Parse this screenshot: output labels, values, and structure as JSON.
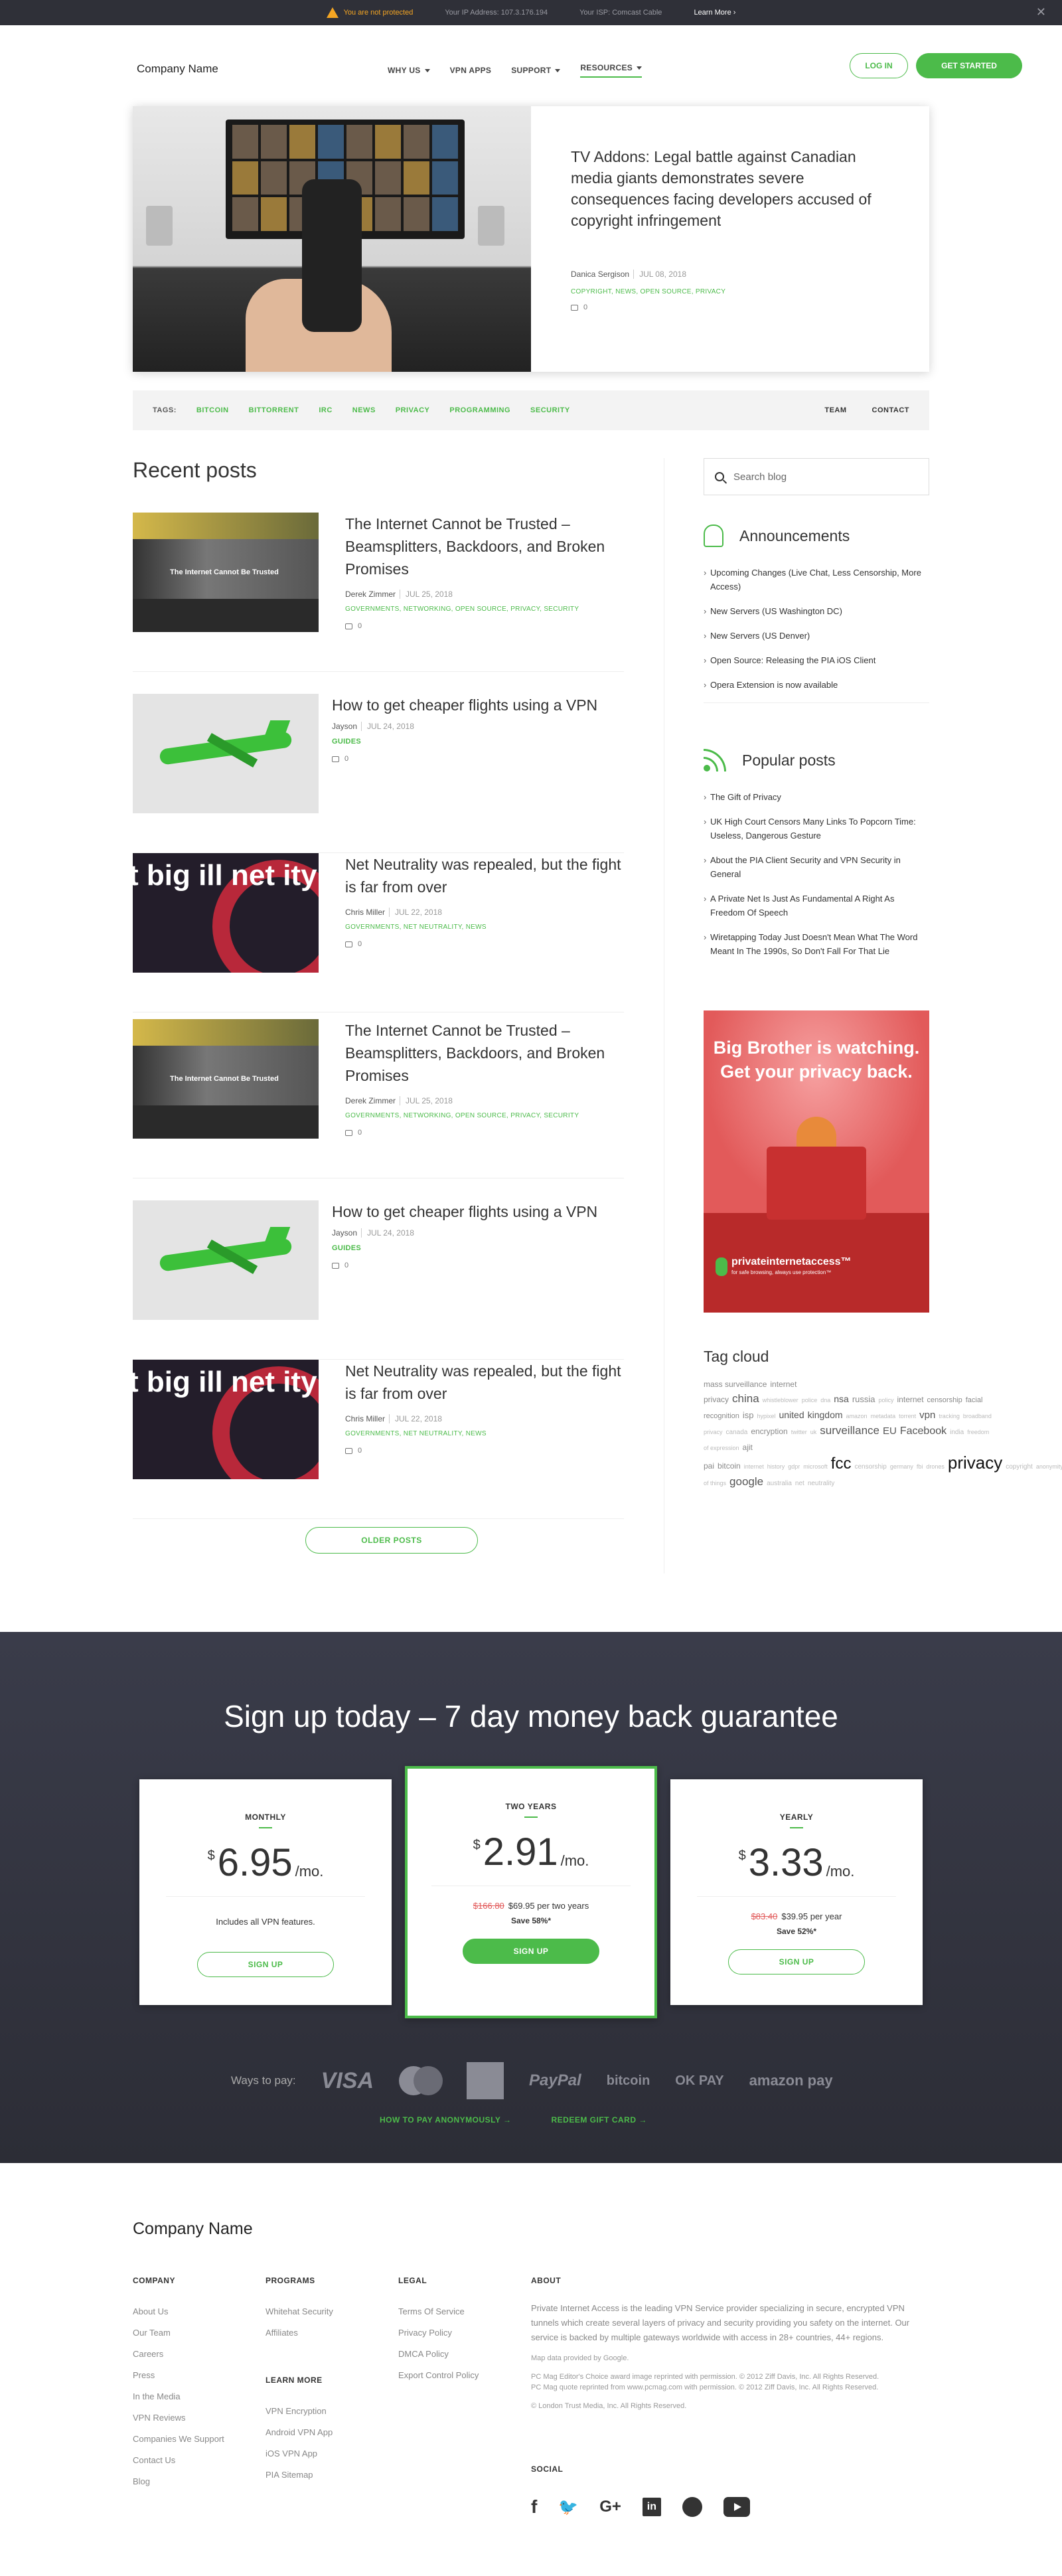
{
  "topbar": {
    "warning": "You are not protected",
    "ip": "Your IP Address: 107.3.176.194",
    "isp": "Your ISP: Comcast Cable",
    "learn_more": "Learn More ›",
    "close": "✕"
  },
  "header": {
    "logo": "Company Name",
    "nav": [
      "WHY US",
      "VPN APPS",
      "SUPPORT",
      "RESOURCES"
    ],
    "login": "LOG IN",
    "get_started": "GET STARTED"
  },
  "hero": {
    "title": "TV Addons: Legal battle against Canadian media giants demonstrates severe consequences facing developers accused of copyright infringement",
    "author": "Danica Sergison",
    "date": "JUL 08, 2018",
    "categories": "COPYRIGHT, NEWS, OPEN SOURCE, PRIVACY",
    "comments": "0"
  },
  "tagsbar": {
    "label": "TAGS:",
    "tags": [
      "BITCOIN",
      "BITTORRENT",
      "IRC",
      "NEWS",
      "PRIVACY",
      "PROGRAMMING",
      "SECURITY"
    ],
    "team": "TEAM",
    "contact": "CONTACT"
  },
  "recent": {
    "heading": "Recent posts",
    "posts": [
      {
        "title": "The Internet Cannot be Trusted – Beamsplitters, Backdoors, and Broken Promises",
        "author": "Derek Zimmer",
        "date": "JUL 25, 2018",
        "categories": "GOVERNMENTS, NETWORKING, OPEN SOURCE, PRIVACY, SECURITY",
        "comments": "0",
        "thumb_text": "The Internet Cannot Be Trusted"
      },
      {
        "title": "How to get cheaper flights using a VPN",
        "author": "Jayson",
        "date": "JUL 24, 2018",
        "categories": "GUIDES",
        "comments": "0"
      },
      {
        "title": "Net Neutrality was repealed, but the fight is far from over",
        "author": "Chris Miller",
        "date": "JUL 22, 2018",
        "categories": "GOVERNMENTS, NET NEUTRALITY, NEWS",
        "comments": "0",
        "thumb_text": "t big ill net ity"
      },
      {
        "title": "The Internet Cannot be Trusted – Beamsplitters, Backdoors, and Broken Promises",
        "author": "Derek Zimmer",
        "date": "JUL 25, 2018",
        "categories": "GOVERNMENTS, NETWORKING, OPEN SOURCE, PRIVACY, SECURITY",
        "comments": "0",
        "thumb_text": "The Internet Cannot Be Trusted"
      },
      {
        "title": "How to get cheaper flights using a VPN",
        "author": "Jayson",
        "date": "JUL 24, 2018",
        "categories": "GUIDES",
        "comments": "0"
      },
      {
        "title": "Net Neutrality was repealed, but the fight is far from over",
        "author": "Chris Miller",
        "date": "JUL 22, 2018",
        "categories": "GOVERNMENTS, NET NEUTRALITY, NEWS",
        "comments": "0",
        "thumb_text": "t big ill net ity"
      }
    ],
    "older": "OLDER POSTS"
  },
  "sidebar": {
    "search_placeholder": "Search blog",
    "announcements": {
      "title": "Announcements",
      "items": [
        "Upcoming Changes (Live Chat, Less Censorship, More Access)",
        "New Servers (US Washington DC)",
        "New Servers (US Denver)",
        "Open Source: Releasing the PIA iOS Client",
        "Opera Extension is now available"
      ]
    },
    "popular": {
      "title": "Popular posts",
      "items": [
        "The Gift of Privacy",
        "UK High Court Censors Many Links To Popcorn Time: Useless, Dangerous Gesture",
        "About the PIA Client Security and VPN Security in General",
        "A Private Net Is Just As Fundamental A Right As Freedom Of Speech",
        "Wiretapping Today Just Doesn't Mean What The Word Meant In The 1990s, So Don't Fall For That Lie"
      ]
    },
    "ad": {
      "headline1": "Big Brother is watching.",
      "headline2": "Get your privacy back.",
      "brand": "privateinternetaccess™",
      "tagline": "for safe browsing, always use protection™"
    },
    "tagcloud": {
      "title": "Tag cloud",
      "tags": [
        {
          "t": "mass surveillance",
          "s": 12
        },
        {
          "t": "internet privacy",
          "s": 12
        },
        {
          "t": "china",
          "s": 17
        },
        {
          "t": "whistleblower",
          "s": 9
        },
        {
          "t": "police",
          "s": 9
        },
        {
          "t": "dna",
          "s": 9
        },
        {
          "t": "nsa",
          "s": 14
        },
        {
          "t": "russia",
          "s": 13
        },
        {
          "t": "policy",
          "s": 9
        },
        {
          "t": "internet",
          "s": 12
        },
        {
          "t": "censorship",
          "s": 11
        },
        {
          "t": "facial recognition",
          "s": 11
        },
        {
          "t": "isp",
          "s": 13
        },
        {
          "t": "hypixel",
          "s": 9
        },
        {
          "t": "united",
          "s": 14
        },
        {
          "t": "kingdom",
          "s": 14
        },
        {
          "t": "amazon",
          "s": 9
        },
        {
          "t": "metadata",
          "s": 9
        },
        {
          "t": "torrent",
          "s": 9
        },
        {
          "t": "vpn",
          "s": 15
        },
        {
          "t": "tracking",
          "s": 9
        },
        {
          "t": "broadband privacy",
          "s": 9
        },
        {
          "t": "canada",
          "s": 10
        },
        {
          "t": "encryption",
          "s": 12
        },
        {
          "t": "twitter",
          "s": 9
        },
        {
          "t": "uk",
          "s": 9
        },
        {
          "t": "surveillance",
          "s": 17
        },
        {
          "t": "EU",
          "s": 15
        },
        {
          "t": "Facebook",
          "s": 16
        },
        {
          "t": "india",
          "s": 10
        },
        {
          "t": "freedom of expression",
          "s": 9
        },
        {
          "t": "ajit pai",
          "s": 12
        },
        {
          "t": "bitcoin",
          "s": 12
        },
        {
          "t": "internet",
          "s": 9
        },
        {
          "t": "history",
          "s": 9
        },
        {
          "t": "gdpr",
          "s": 9
        },
        {
          "t": "microsoft",
          "s": 9
        },
        {
          "t": "fcc",
          "s": 24
        },
        {
          "t": "censorship",
          "s": 10
        },
        {
          "t": "germany",
          "s": 9
        },
        {
          "t": "fbi",
          "s": 9
        },
        {
          "t": "drones",
          "s": 9
        },
        {
          "t": "privacy",
          "s": 26
        },
        {
          "t": "copyright",
          "s": 10
        },
        {
          "t": "anonymity",
          "s": 9
        },
        {
          "t": "internet of things",
          "s": 9
        },
        {
          "t": "google",
          "s": 17
        },
        {
          "t": "australia",
          "s": 10
        },
        {
          "t": "net",
          "s": 10
        },
        {
          "t": "neutrality",
          "s": 10
        }
      ]
    }
  },
  "signup": {
    "heading": "Sign up today – 7 day money back guarantee",
    "plans": [
      {
        "name": "MONTHLY",
        "currency": "$",
        "price": "6.95",
        "per": "/mo.",
        "note": "Includes all VPN features.",
        "button": "SIGN UP"
      },
      {
        "name": "TWO YEARS",
        "currency": "$",
        "price": "2.91",
        "per": "/mo.",
        "old": "$166.80",
        "new": "$69.95 per two years",
        "save": "Save 58%*",
        "button": "SIGN UP"
      },
      {
        "name": "YEARLY",
        "currency": "$",
        "price": "3.33",
        "per": "/mo.",
        "old": "$83.40",
        "new": "$39.95 per year",
        "save": "Save 52%*",
        "button": "SIGN UP"
      }
    ],
    "ways_to_pay": "Ways to pay:",
    "payments": {
      "visa": "VISA",
      "mastercard": "mastercard",
      "paypal": "PayPal",
      "bitcoin": "bitcoin",
      "okpay": "OK PAY",
      "amazon": "amazon pay"
    },
    "anon_link": "HOW TO PAY ANONYMOUSLY →",
    "gift_link": "REDEEM GIFT CARD →"
  },
  "footer": {
    "logo": "Company Name",
    "company": {
      "title": "COMPANY",
      "links": [
        "About Us",
        "Our Team",
        "Careers",
        "Press",
        "In the Media",
        "VPN Reviews",
        "Companies We Support",
        "Contact Us",
        "Blog"
      ]
    },
    "programs": {
      "title": "PROGRAMS",
      "links": [
        "Whitehat Security",
        "Affiliates"
      ]
    },
    "learn": {
      "title": "LEARN MORE",
      "links": [
        "VPN Encryption",
        "Android VPN App",
        "iOS VPN App",
        "PIA Sitemap"
      ]
    },
    "legal": {
      "title": "LEGAL",
      "links": [
        "Terms Of Service",
        "Privacy Policy",
        "DMCA Policy",
        "Export Control Policy"
      ]
    },
    "about": {
      "title": "ABOUT",
      "text": "Private Internet Access is the leading VPN Service provider specializing in secure, encrypted VPN tunnels which create several layers of privacy and security providing you safety on the internet. Our service is backed by multiple gateways worldwide with access in 28+ countries, 44+ regions.",
      "map": "Map data provided by Google.",
      "pcmag1": "PC Mag Editor's Choice award image reprinted with permission. © 2012 Ziff Davis, Inc. All Rights Reserved.",
      "pcmag2": "PC Mag quote reprinted from www.pcmag.com with permission. © 2012 Ziff Davis, Inc. All Rights Reserved.",
      "copyright": "© London Trust Media, Inc. All Rights Reserved."
    },
    "social_title": "SOCIAL",
    "social": {
      "facebook": "f",
      "twitter": "🐦",
      "google": "G+",
      "linkedin": "in"
    }
  }
}
